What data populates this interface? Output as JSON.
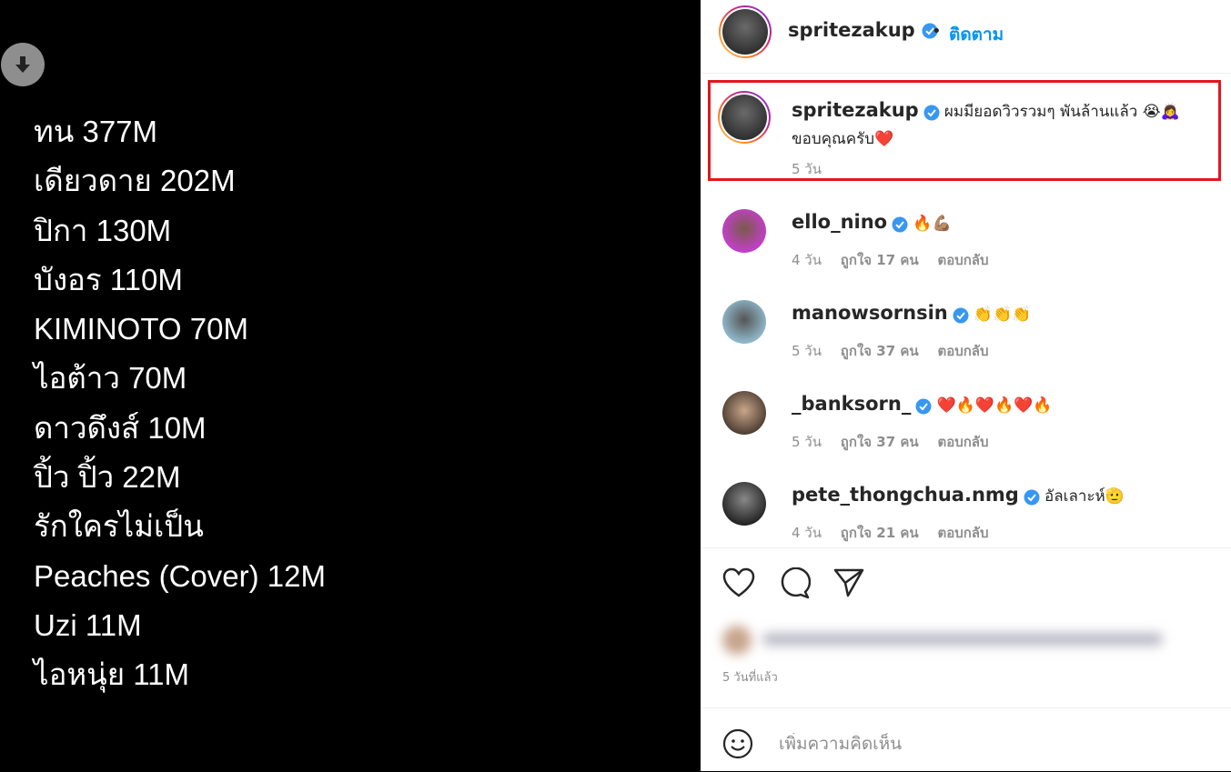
{
  "media": {
    "download_icon": "download-arrow-icon",
    "songs": [
      "ทน 377M",
      "เดียวดาย 202M",
      "ปิกา 130M",
      "บังอร 110M",
      "KIMINOTO 70M",
      "ไอต้าว 70M",
      "ดาวดึงส์ 10M",
      "ปิ้ว ปิ้ว 22M",
      "รักใครไม่เป็น",
      "Peaches (Cover) 12M",
      "Uzi 11M",
      "ไอหนุ่ย 11M"
    ]
  },
  "header": {
    "username": "spritezakup",
    "dot": "•",
    "follow_label": "ติดตาม"
  },
  "caption": {
    "username": "spritezakup",
    "text": "ผมมียอดวิวรวมๆ พันล้านแล้ว 😭🙇‍♀️ ขอบคุณครับ❤️",
    "time": "5 วัน"
  },
  "comments": [
    {
      "username": "ello_nino",
      "text": "🔥💪🏽",
      "time": "4 วัน",
      "likes": "ถูกใจ 17 คน",
      "reply": "ตอบกลับ"
    },
    {
      "username": "manowsornsin",
      "text": "👏👏👏",
      "time": "5 วัน",
      "likes": "ถูกใจ 37 คน",
      "reply": "ตอบกลับ"
    },
    {
      "username": "_banksorn_",
      "text": "❤️🔥❤️🔥❤️🔥",
      "time": "5 วัน",
      "likes": "ถูกใจ 37 คน",
      "reply": "ตอบกลับ"
    },
    {
      "username": "pete_thongchua.nmg",
      "text": "อัลเลาะห์🫡",
      "time": "4 วัน",
      "likes": "ถูกใจ 21 คน",
      "reply": "ตอบกลับ"
    }
  ],
  "footer": {
    "time_ago": "5 วันที่แล้ว",
    "comment_placeholder": "เพิ่มความคิดเห็น"
  },
  "colors": {
    "link": "#0095f6",
    "verified": "#3897f0",
    "highlight": "#e0171f"
  }
}
